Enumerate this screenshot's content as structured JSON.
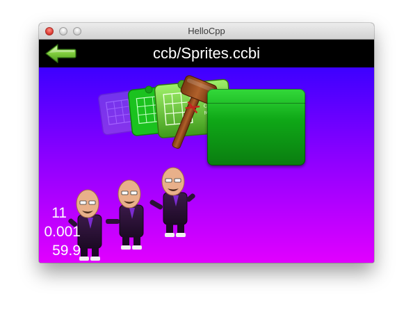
{
  "window": {
    "title": "HelloCpp"
  },
  "scene": {
    "title": "ccb/Sprites.ccbi"
  },
  "header": {
    "back_icon": "left-arrow-icon"
  },
  "colors": {
    "header_bg": "#000000",
    "canvas_top": "#3d00ff",
    "canvas_bottom": "#e100ff",
    "stat_text": "#ffffff",
    "button_green": "#1ab821",
    "arrow_green": "#7fcc3c"
  },
  "stats": {
    "objects": "11",
    "frame_time": "0.001",
    "fps": "59.9"
  }
}
